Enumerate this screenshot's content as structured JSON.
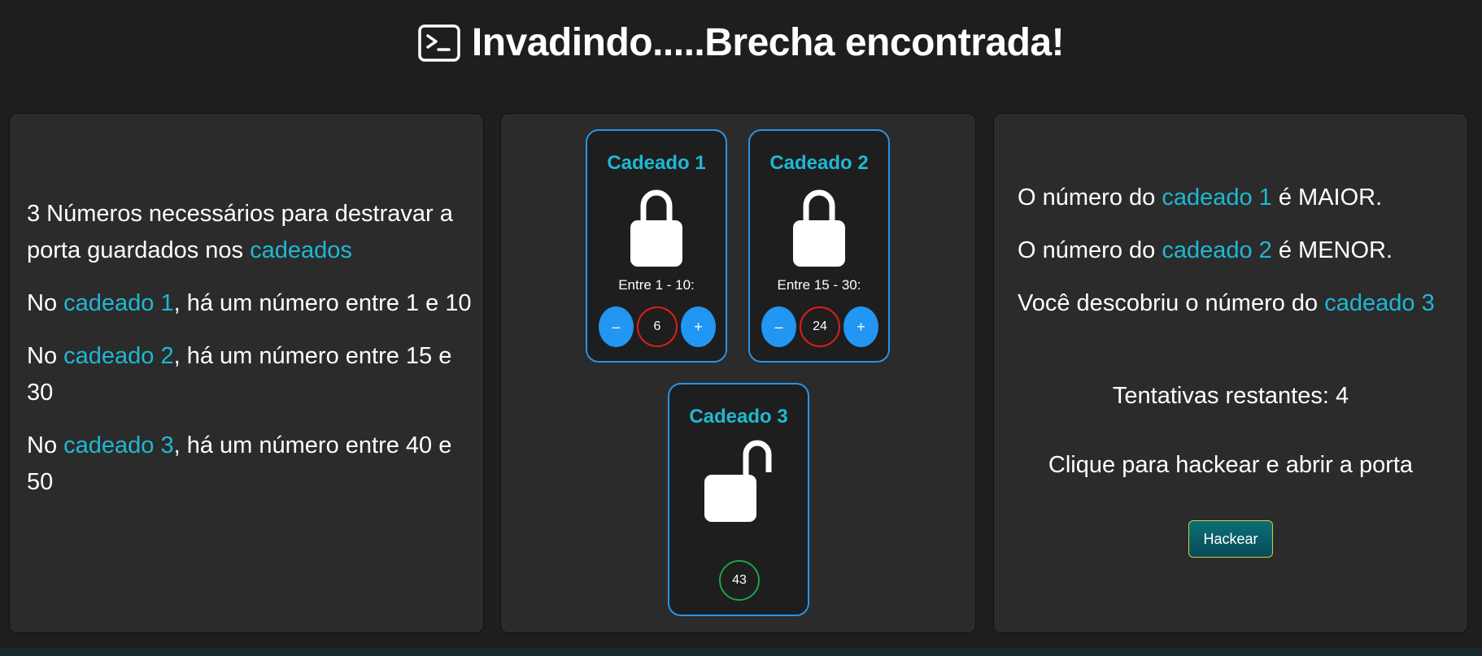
{
  "header": {
    "title": "Invadindo.....Brecha encontrada!",
    "icon": "terminal-icon"
  },
  "left_panel": {
    "intro_before": "3 Números necessários para destravar a porta guardados nos ",
    "intro_highlight": "cadeados",
    "clues": [
      {
        "prefix": "No ",
        "highlight": "cadeado 1",
        "suffix": ", há um número entre 1 e 10"
      },
      {
        "prefix": "No ",
        "highlight": "cadeado 2",
        "suffix": ", há um número entre 15 e 30"
      },
      {
        "prefix": "No ",
        "highlight": "cadeado 3",
        "suffix": ", há um número entre 40 e 50"
      }
    ]
  },
  "locks": [
    {
      "name": "Cadeado 1",
      "range": "Entre 1 - 10:",
      "minus": "–",
      "plus": "+",
      "value": "6",
      "state": "locked"
    },
    {
      "name": "Cadeado 2",
      "range": "Entre 15 - 30:",
      "minus": "–",
      "plus": "+",
      "value": "24",
      "state": "locked"
    },
    {
      "name": "Cadeado 3",
      "value": "43",
      "state": "unlocked"
    }
  ],
  "right_panel": {
    "hints": [
      {
        "prefix": "O número do ",
        "highlight": "cadeado 1",
        "suffix": " é MAIOR."
      },
      {
        "prefix": "O número do ",
        "highlight": "cadeado 2",
        "suffix": " é MENOR."
      },
      {
        "prefix": "Você descobriu o número do ",
        "highlight": "cadeado 3",
        "suffix": ""
      }
    ],
    "tries": "Tentativas restantes: 4",
    "hack_message": "Clique para hackear e abrir a porta",
    "hack_button": "Hackear"
  },
  "colors": {
    "background": "#1e1e1e",
    "panel": "#2b2b2b",
    "highlight": "#1fb8d3",
    "accent_blue": "#2196f3",
    "error_red": "#e21c1c",
    "success_green": "#22a045"
  }
}
